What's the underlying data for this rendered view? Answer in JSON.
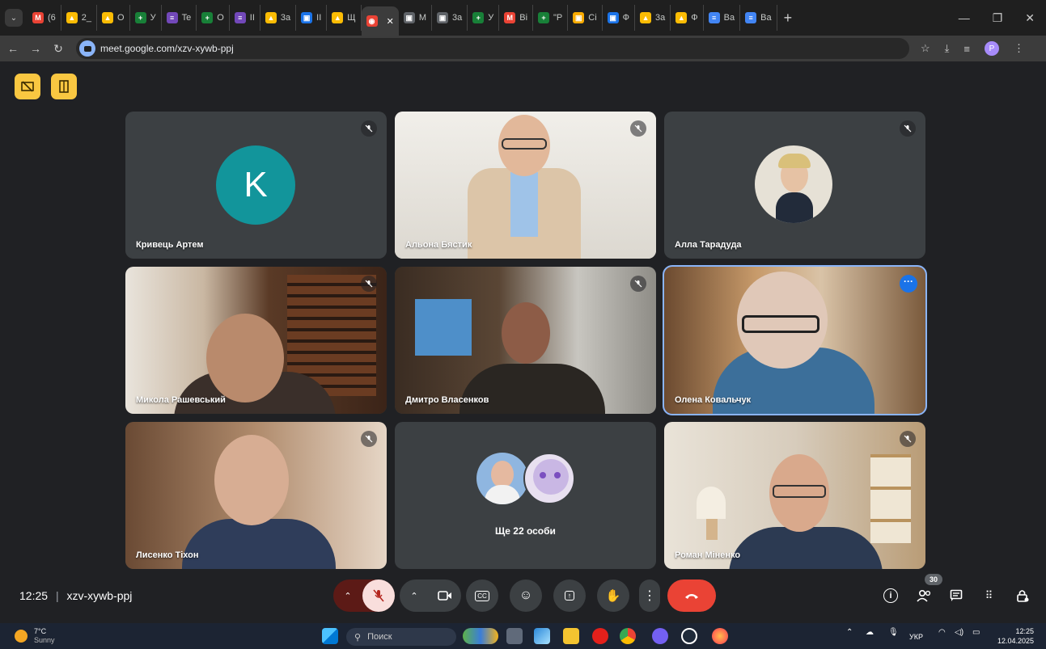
{
  "browser": {
    "tabs": [
      {
        "label": "(6",
        "favicon": "gmail-icon",
        "color": "#ea4335",
        "glyph": "M"
      },
      {
        "label": "2_",
        "favicon": "drive-icon",
        "color": "#fbbc04",
        "glyph": "▲"
      },
      {
        "label": "O",
        "favicon": "drive-icon",
        "color": "#fbbc04",
        "glyph": "▲"
      },
      {
        "label": "У",
        "favicon": "sheets-icon",
        "color": "#188038",
        "glyph": "+"
      },
      {
        "label": "Te",
        "favicon": "forms-icon",
        "color": "#7248b9",
        "glyph": "≡"
      },
      {
        "label": "O",
        "favicon": "sheets-icon",
        "color": "#188038",
        "glyph": "+"
      },
      {
        "label": "II",
        "favicon": "forms-icon",
        "color": "#7248b9",
        "glyph": "≡"
      },
      {
        "label": "3a",
        "favicon": "drive-icon",
        "color": "#fbbc04",
        "glyph": "▲"
      },
      {
        "label": "II",
        "favicon": "image-icon",
        "color": "#1a73e8",
        "glyph": "▣"
      },
      {
        "label": "Щ",
        "favicon": "drive-icon",
        "color": "#fbbc04",
        "glyph": "▲"
      },
      {
        "label": "",
        "favicon": "meet-recording-icon",
        "color": "#ea4335",
        "glyph": "◉",
        "active": true
      },
      {
        "label": "M",
        "favicon": "image-icon",
        "color": "#5f6368",
        "glyph": "▣"
      },
      {
        "label": "3a",
        "favicon": "image-icon",
        "color": "#5f6368",
        "glyph": "▣"
      },
      {
        "label": "У",
        "favicon": "sheets-icon",
        "color": "#188038",
        "glyph": "+"
      },
      {
        "label": "Bi",
        "favicon": "gmail-icon",
        "color": "#ea4335",
        "glyph": "M"
      },
      {
        "label": "\"P",
        "favicon": "sheets-icon",
        "color": "#188038",
        "glyph": "+"
      },
      {
        "label": "Ci",
        "favicon": "image-icon",
        "color": "#f9ab00",
        "glyph": "▣"
      },
      {
        "label": "Ф",
        "favicon": "image-icon",
        "color": "#1a73e8",
        "glyph": "▣"
      },
      {
        "label": "3a",
        "favicon": "drive-icon",
        "color": "#fbbc04",
        "glyph": "▲"
      },
      {
        "label": "Ф",
        "favicon": "drive-icon",
        "color": "#fbbc04",
        "glyph": "▲"
      },
      {
        "label": "Ba",
        "favicon": "docs-icon",
        "color": "#4285f4",
        "glyph": "≡"
      },
      {
        "label": "Ba",
        "favicon": "docs-icon",
        "color": "#4285f4",
        "glyph": "≡"
      }
    ],
    "url": "meet.google.com/xzv-xywb-ppj",
    "profile_initial": "P"
  },
  "meet": {
    "participants": [
      {
        "name": "Кривець Артем",
        "type": "letter",
        "letter": "K",
        "muted": true
      },
      {
        "name": "Альона Бястик",
        "type": "video",
        "muted": true
      },
      {
        "name": "Алла Тарадуда",
        "type": "photo",
        "muted": true
      },
      {
        "name": "Микола Рашевський",
        "type": "video",
        "muted": true
      },
      {
        "name": "Дмитро Власенков",
        "type": "video",
        "muted": true
      },
      {
        "name": "Олена Ковальчук",
        "type": "video",
        "muted": false,
        "speaking": true
      },
      {
        "name": "Лисенко Тіхон",
        "type": "video",
        "muted": true
      },
      {
        "name": "",
        "type": "more",
        "label": "Ще 22 особи"
      },
      {
        "name": "Роман Міненко",
        "type": "video",
        "muted": true
      }
    ],
    "time": "12:25",
    "meeting_code": "xzv-xywb-ppj",
    "participants_count": "30",
    "accent": "#8ab4f8",
    "end_call_color": "#ea4335"
  },
  "taskbar": {
    "temperature": "7°C",
    "weather": "Sunny",
    "search_placeholder": "Поиск",
    "language": "УКР",
    "time": "12:25",
    "date": "12.04.2025"
  }
}
